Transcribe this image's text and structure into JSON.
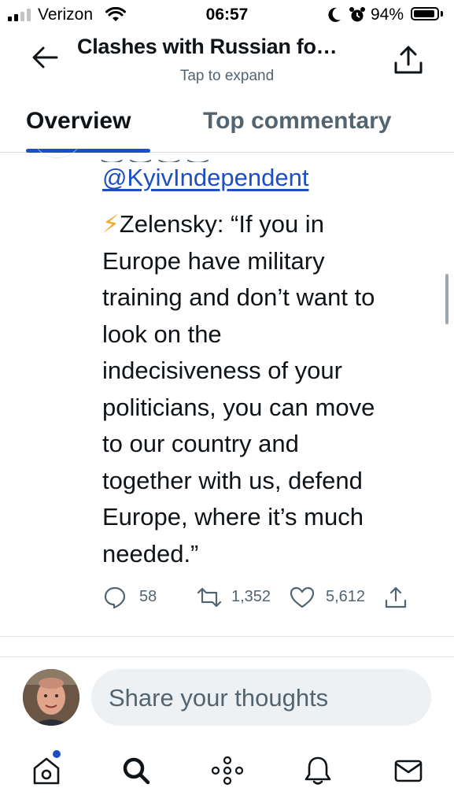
{
  "status_bar": {
    "carrier": "Verizon",
    "time": "06:57",
    "battery": "94%",
    "battery_level": 0.94,
    "icons": [
      "signal-icon",
      "wifi-icon",
      "moon-icon",
      "alarm-icon",
      "battery-icon"
    ]
  },
  "header": {
    "title": "Clashes with Russian fo…",
    "subtitle": "Tap to expand",
    "back_icon": "back-arrow-icon",
    "share_icon": "share-icon"
  },
  "tabs": [
    {
      "label": "Overview",
      "active": true
    },
    {
      "label": "Top commentary",
      "active": false
    }
  ],
  "tweet": {
    "mention": "@KyivIndependent",
    "emoji": "⚡",
    "text": "Zelensky: “If you in\nEurope have military\ntraining and don’t want to\nlook on the\nindecisiveness of your\npoliticians, you can move\nto our country and\ntogether with us, defend\nEurope, where it’s much\nneeded.”",
    "replies": "58",
    "retweets": "1,352",
    "likes": "5,612"
  },
  "composer": {
    "placeholder": "Share your thoughts"
  },
  "bottom_nav": {
    "items": [
      "home-icon",
      "search-icon",
      "spaces-icon",
      "notifications-icon",
      "messages-icon"
    ],
    "home_has_notification": true
  },
  "colors": {
    "accent": "#1d4ec4",
    "text_primary": "#0f1419",
    "text_secondary": "#536471",
    "compose_bg": "#eef1f4"
  }
}
